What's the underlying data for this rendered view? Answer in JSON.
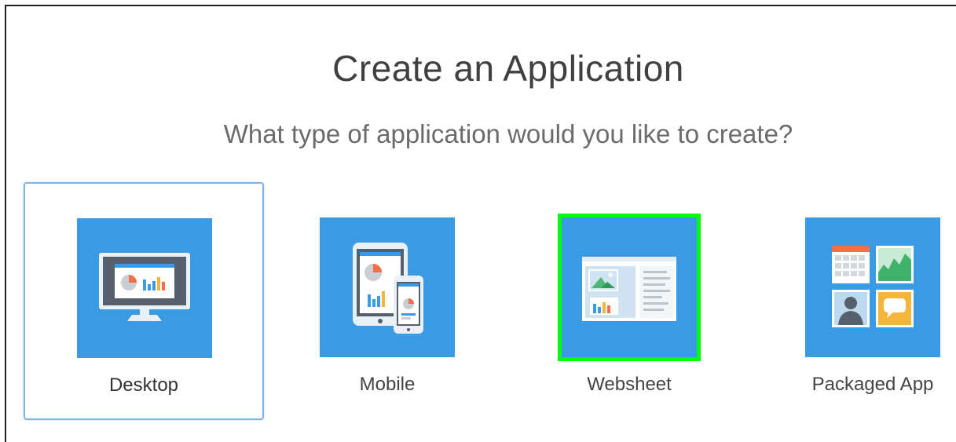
{
  "page": {
    "title": "Create an Application",
    "subtitle": "What type of application would you like to create?"
  },
  "options": [
    {
      "label": "Desktop",
      "icon": "desktop-monitor-icon",
      "selected": true
    },
    {
      "label": "Mobile",
      "icon": "tablet-phone-icon",
      "selected": false
    },
    {
      "label": "Websheet",
      "icon": "websheet-icon",
      "highlighted": true
    },
    {
      "label": "Packaged App",
      "icon": "packaged-app-grid-icon",
      "selected": false
    }
  ],
  "colors": {
    "tile": "#3a9be4",
    "highlight": "#00ff0b",
    "selected_border": "#7fb3e6"
  }
}
